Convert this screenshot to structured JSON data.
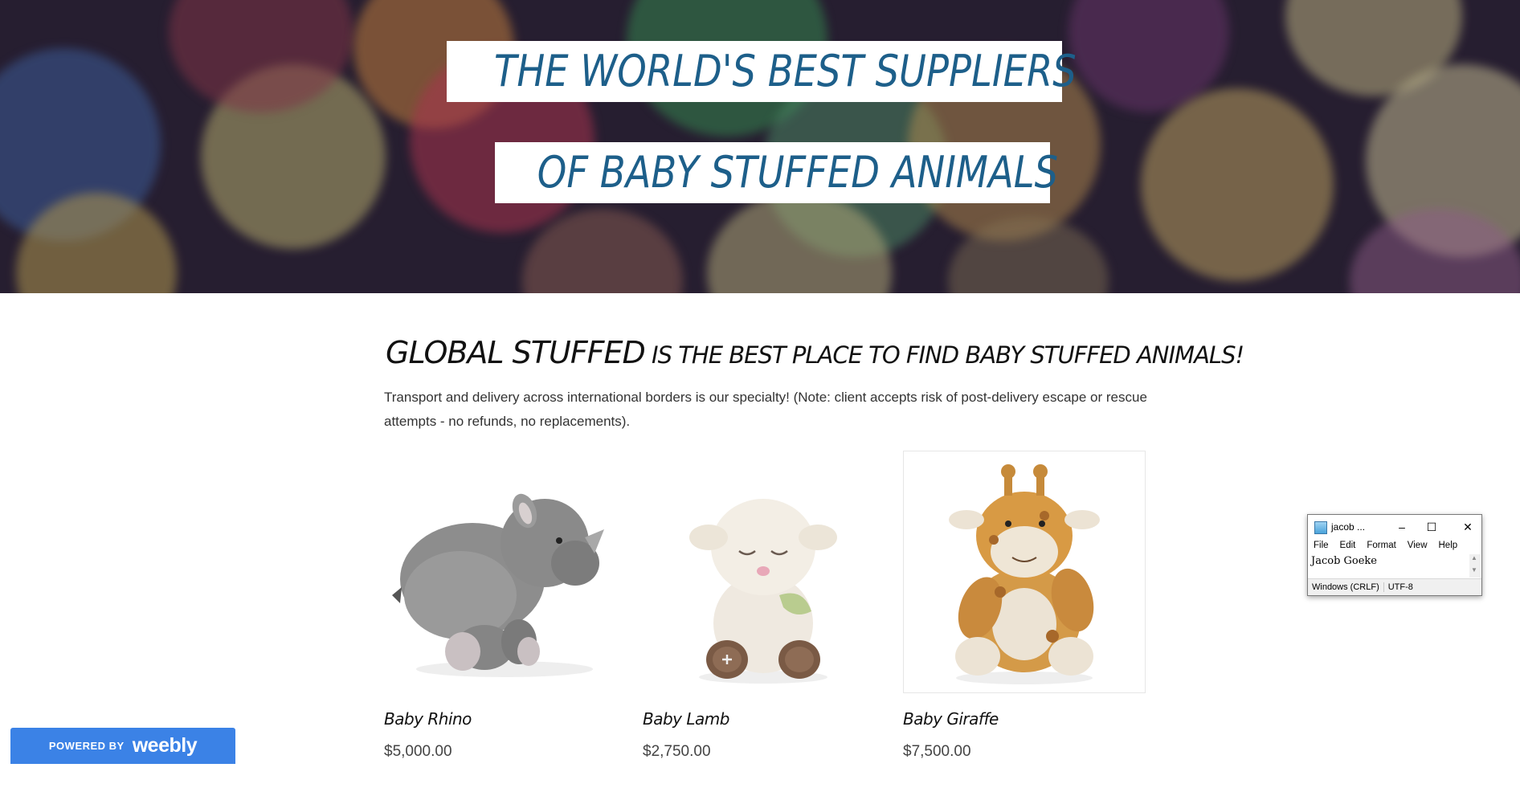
{
  "hero": {
    "line1": "THE WORLD'S BEST SUPPLIERS",
    "line2": "OF BABY STUFFED ANIMALS"
  },
  "headline": {
    "brand": "GLOBAL STUFFED",
    "rest": " IS THE BEST PLACE TO FIND BABY STUFFED ANIMALS!"
  },
  "intro": "Transport and delivery across international borders is our specialty!  (Note: client accepts risk of post-delivery escape or rescue attempts -  no refunds, no replacements).",
  "products": [
    {
      "name": "Baby Rhino",
      "price": "$5,000.00"
    },
    {
      "name": "Baby Lamb",
      "price": "$2,750.00"
    },
    {
      "name": "Baby Giraffe",
      "price": "$7,500.00"
    }
  ],
  "weebly": {
    "powered_by": "POWERED BY",
    "brand": "weebly"
  },
  "notepad": {
    "title": "jacob ...",
    "menu": [
      "File",
      "Edit",
      "Format",
      "View",
      "Help"
    ],
    "content": "Jacob Goeke",
    "status": [
      "Windows (CRLF)",
      "UTF-8"
    ]
  },
  "colors": {
    "hero_text": "#1d5f8a",
    "weebly_blue": "#3b82e6"
  }
}
